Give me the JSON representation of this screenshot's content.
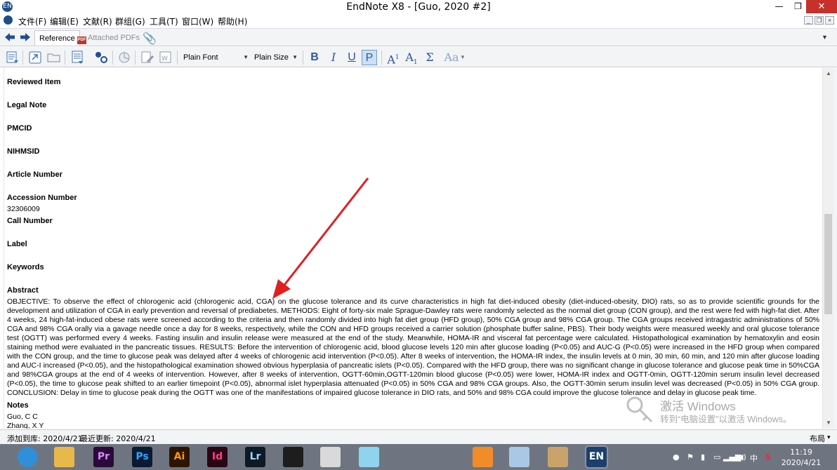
{
  "window": {
    "title": "EndNote X8 - [Guo, 2020 #2]",
    "app_icon_text": "EN",
    "controls": {
      "minimize": "—",
      "maximize": "❐",
      "close": "✕"
    }
  },
  "menu": {
    "items": [
      "文件(F)",
      "编辑(E)",
      "文献(R)",
      "群组(G)",
      "工具(T)",
      "窗口(W)",
      "帮助(H)"
    ],
    "mdi_controls": [
      "_",
      "❐",
      "×"
    ]
  },
  "tabs": {
    "reference": "Reference",
    "attached_pdfs": "Attached PDFs",
    "pdf_badge": "PDF"
  },
  "toolbar": {
    "font_select": "Plain Font",
    "size_select": "Plain Size",
    "bold": "B",
    "italic": "I",
    "underline": "U",
    "plain": "P",
    "superscript_base": "A",
    "superscript_mark": "1",
    "subscript_base": "A",
    "subscript_mark": "1",
    "sigma": "Σ",
    "case": "Aa"
  },
  "fields": [
    {
      "label": "Reviewed Item",
      "value": ""
    },
    {
      "label": "Legal Note",
      "value": ""
    },
    {
      "label": "PMCID",
      "value": ""
    },
    {
      "label": "NIHMSID",
      "value": ""
    },
    {
      "label": "Article Number",
      "value": ""
    },
    {
      "label": "Accession Number",
      "value": "32306009"
    },
    {
      "label": "Call Number",
      "value": ""
    },
    {
      "label": "Label",
      "value": ""
    },
    {
      "label": "Keywords",
      "value": ""
    }
  ],
  "abstract": {
    "label": "Abstract",
    "text": "OBJECTIVE: To observe the effect of chlorogenic acid (chlorogenic acid, CGA) on the glucose tolerance and its curve characteristics in high fat diet-induced obesity (diet-induced-obesity, DIO) rats, so as to provide scientific grounds for the development and utilization of CGA in early prevention and reversal of prediabetes. METHODS: Eight of forty-six male Sprague-Dawley rats were randomly selected as the normal diet group (CON group), and the rest were fed with high-fat diet. After 4 weeks, 24 high-fat-induced obese rats were screened according to the criteria and then randomly divided into high fat diet group (HFD group), 50% CGA group and 98% CGA group. The CGA groups received intragastric administrations of 50% CGA and 98% CGA orally via a gavage needle once a day for 8 weeks, respectively, while the CON and HFD groups received a carrier solution (phosphate buffer saline, PBS). Their body weights were measured weekly and oral glucose tolerance test (OGTT) was performed every 4 weeks. Fasting insulin and insulin release were measured at the end of the study. Meanwhile, HOMA-IR and visceral fat percentage were calculated. Histopathological examination by hematoxylin and eosin staining method were evaluated in the pancreatic tissues. RESULTS: Before the intervention of chlorogenic acid, blood glucose levels 120 min after glucose loading (P<0.05) and AUC-G (P<0.05) were increased in the HFD group when compared with the CON group, and the time to glucose peak was delayed after 4 weeks of chlorogenic acid intervention (P<0.05). After 8 weeks of intervention, the HOMA-IR index, the insulin levels at 0 min, 30 min, 60 min, and 120 min after glucose loading and AUC-I increased (P<0.05), and the histopathological examination showed obvious hyperplasia of pancreatic islets (P<0.05). Compared with the HFD group, there was no significant change in glucose tolerance and glucose peak time in 50%CGA and 98%CGA groups at the end of 4 weeks of intervention. However, after 8 weeks of intervention, OGTT-60min,OGTT-120min blood glucose (P<0.05) were lower, HOMA-IR index and OGTT-0min, OGTT-120min serum insulin level decreased (P<0.05), the time to glucose peak shifted to an earlier timepoint (P<0.05), abnormal islet hyperplasia attenuated (P<0.05) in 50% CGA and 98% CGA groups. Also, the OGTT-30min serum insulin level was decreased (P<0.05) in 50% CGA group. CONCLUSION: Delay in time to glucose peak during the OGTT was one of the manifestations of impaired glucose tolerance in DIO rats, and 50% and 98% CGA could improve the glucose tolerance and delay in glucose peak time."
  },
  "notes": {
    "label": "Notes",
    "line1": "Guo, C C",
    "line2": "Zhang, X Y"
  },
  "watermark": {
    "line1": "激活 Windows",
    "line2": "转到“电脑设置”以激活 Windows。"
  },
  "status": {
    "added_label": "添加到库: 2020/4/21",
    "updated_label": "最近更新: 2020/4/21",
    "layout": "布局",
    "layout_arrow": "▾"
  },
  "taskbar": {
    "apps": [
      {
        "name": "browser-360",
        "text": "",
        "bg": "#2f8fd8",
        "fg": "#ffffff"
      },
      {
        "name": "file-explorer",
        "text": "",
        "bg": "#e8b94a",
        "fg": "#ffffff"
      },
      {
        "name": "premiere",
        "text": "Pr",
        "bg": "#2a0a3a",
        "fg": "#d98cff"
      },
      {
        "name": "photoshop",
        "text": "Ps",
        "bg": "#0a1a33",
        "fg": "#31a8ff"
      },
      {
        "name": "illustrator",
        "text": "Ai",
        "bg": "#2b1500",
        "fg": "#ff9a00"
      },
      {
        "name": "indesign",
        "text": "Id",
        "bg": "#2a0615",
        "fg": "#ff3d8b"
      },
      {
        "name": "lightroom",
        "text": "Lr",
        "bg": "#0c1a26",
        "fg": "#9fd4ff"
      },
      {
        "name": "video-editor",
        "text": "",
        "bg": "#1d1d1d",
        "fg": "#ffffff"
      },
      {
        "name": "pdf-reader",
        "text": "",
        "bg": "#d9d9d9",
        "fg": "#c62828"
      },
      {
        "name": "bird-app",
        "text": "",
        "bg": "#8fd3ef",
        "fg": "#ffffff"
      },
      {
        "name": "qq",
        "text": "",
        "bg": "#6f7580",
        "fg": "#000000"
      },
      {
        "name": "chrome",
        "text": "",
        "bg": "#6f7580",
        "fg": "#ffffff"
      },
      {
        "name": "player",
        "text": "",
        "bg": "#f28c28",
        "fg": "#ffffff"
      },
      {
        "name": "notepad",
        "text": "",
        "bg": "#a8c8e6",
        "fg": "#ffffff"
      },
      {
        "name": "tool-app",
        "text": "",
        "bg": "#c9a36a",
        "fg": "#ffffff"
      },
      {
        "name": "endnote",
        "text": "EN",
        "bg": "#1c3f6e",
        "fg": "#ffffff"
      }
    ],
    "clock_time": "11:19",
    "clock_date": "2020/4/21",
    "ime": "中"
  },
  "colors": {
    "arrow": "#e02020",
    "accent": "#2b55a3"
  }
}
